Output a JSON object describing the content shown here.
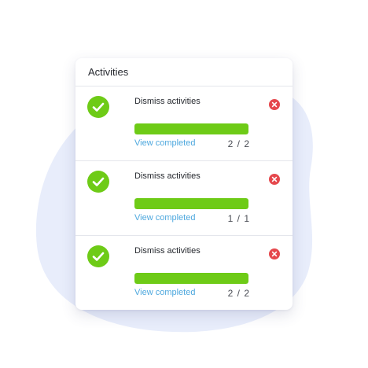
{
  "card": {
    "title": "Activities"
  },
  "activities": [
    {
      "label": "Dismiss activities",
      "link": "View completed",
      "count": "2 / 2",
      "progress": 1.0
    },
    {
      "label": "Dismiss activities",
      "link": "View completed",
      "count": "1 / 1",
      "progress": 1.0
    },
    {
      "label": "Dismiss activities",
      "link": "View completed",
      "count": "2 / 2",
      "progress": 1.0
    }
  ],
  "icons": {
    "check": "check-circle-icon",
    "close": "close-circle-icon"
  },
  "colors": {
    "accent_green": "#6ecb17",
    "link_blue": "#4ea8de",
    "close_red": "#e5484d",
    "blob": "#e8edfb"
  }
}
